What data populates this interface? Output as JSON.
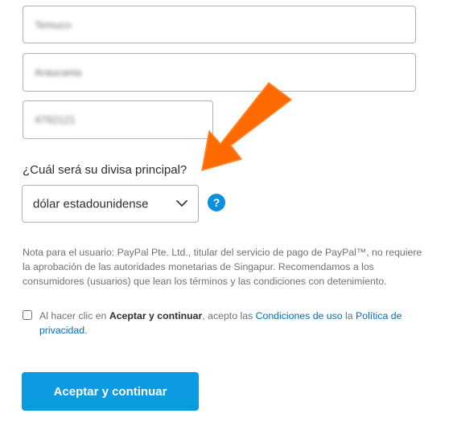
{
  "address": {
    "city_value": "Temuco",
    "region_value": "Araucania",
    "postal_value": "4792121"
  },
  "currency": {
    "question": "¿Cuál será su divisa principal?",
    "selected": "dólar estadounidense",
    "help_glyph": "?"
  },
  "note": {
    "text": "Nota para el usuario: PayPal Pte. Ltd., titular del servicio de pago de PayPal™, no requiere la aprobación de las autoridades monetarias de Singapur. Recomendamos a los consumidores (usuarios) que lean los términos y las condiciones con detenimiento."
  },
  "agreement": {
    "prefix": "Al hacer clic en ",
    "bold": "Aceptar y continuar",
    "middle": ", acepto las ",
    "terms_link": "Condiciones de uso",
    "connector": " la ",
    "privacy_link": "Política de privacidad",
    "suffix": "."
  },
  "submit": {
    "label": "Aceptar y continuar"
  },
  "colors": {
    "accent": "#0c9ae0",
    "link": "#0070ba",
    "annotation_arrow": "#ff6a00"
  }
}
